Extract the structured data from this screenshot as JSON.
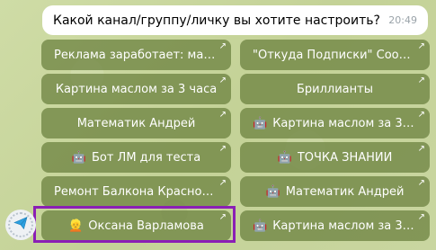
{
  "message": {
    "text": "Какой канал/группу/личку вы хотите настроить?",
    "time": "20:49"
  },
  "keyboard": {
    "buttons": [
      {
        "emoji": "",
        "label": "Реклама заработает: марке..."
      },
      {
        "emoji": "",
        "label": "\"Откуда Подписки\" Сообще..."
      },
      {
        "emoji": "",
        "label": "Картина маслом за 3 часа"
      },
      {
        "emoji": "",
        "label": "Бриллианты"
      },
      {
        "emoji": "",
        "label": "Математик Андрей"
      },
      {
        "emoji": "🤖",
        "label": "Картина маслом за 3 ч..."
      },
      {
        "emoji": "🤖",
        "label": "Бот ЛМ для теста"
      },
      {
        "emoji": "🤖",
        "label": "ТОЧКА ЗНАНИЙ"
      },
      {
        "emoji": "",
        "label": "Ремонт Балкона Краснодар ..."
      },
      {
        "emoji": "🤖",
        "label": "Математик Андрей"
      },
      {
        "emoji": "👱",
        "label": "Оксана Варламова"
      },
      {
        "emoji": "🤖",
        "label": "Картина маслом за 3 часа"
      }
    ],
    "arrow_glyph": "↗"
  },
  "highlight_color": "#8a1fb5",
  "avatar": {
    "icon": "paper-plane-icon"
  }
}
